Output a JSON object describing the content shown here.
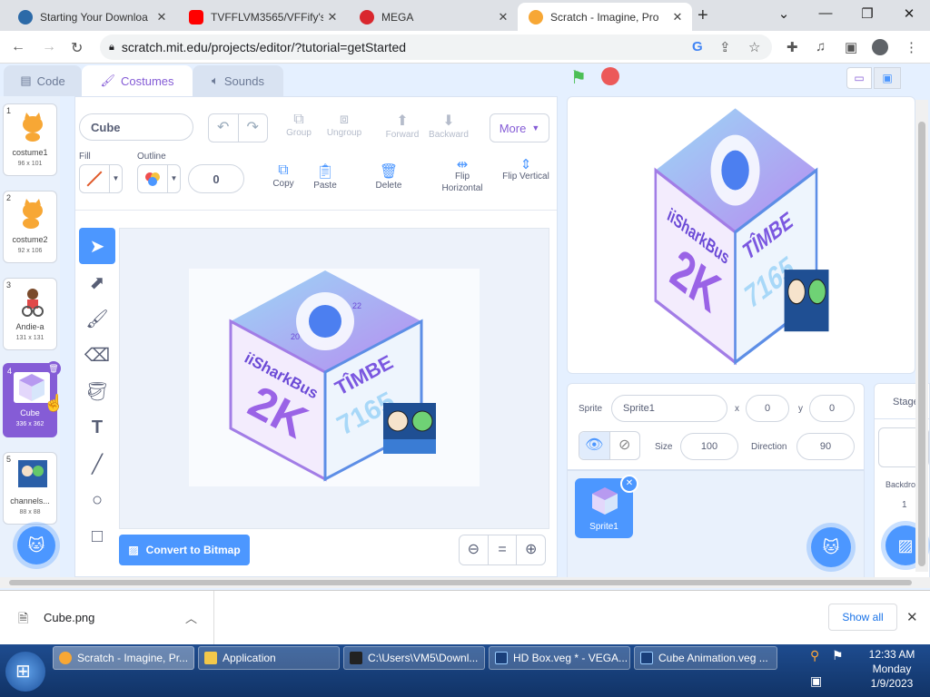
{
  "browser": {
    "tabs": [
      {
        "title": "Starting Your Downloa",
        "favicon_color": "#2c6aa8"
      },
      {
        "title": "TVFFLVM3565/VFFify's",
        "favicon_color": "#ff0000"
      },
      {
        "title": "MEGA",
        "favicon_color": "#d9272e"
      },
      {
        "title": "Scratch - Imagine, Pro",
        "favicon_color": "#f7a735"
      }
    ],
    "new_tab": "+",
    "url": "scratch.mit.edu/projects/editor/?tutorial=getStarted"
  },
  "scratch": {
    "tabs": {
      "code": "Code",
      "costumes": "Costumes",
      "sounds": "Sounds"
    },
    "costumes": [
      {
        "num": "1",
        "name": "costume1",
        "size": "96 x 101"
      },
      {
        "num": "2",
        "name": "costume2",
        "size": "92 x 106"
      },
      {
        "num": "3",
        "name": "Andie-a",
        "size": "131 x 131"
      },
      {
        "num": "4",
        "name": "Cube",
        "size": "336 x 362"
      },
      {
        "num": "5",
        "name": "channels...",
        "size": "88 x 88"
      }
    ],
    "editor": {
      "costume_name": "Cube",
      "fill_label": "Fill",
      "outline_label": "Outline",
      "outline_width": "0",
      "group": "Group",
      "ungroup": "Ungroup",
      "forward": "Forward",
      "backward": "Backward",
      "more": "More",
      "copy": "Copy",
      "paste": "Paste",
      "delete": "Delete",
      "flip_h": "Flip Horizontal",
      "flip_v": "Flip Vertical",
      "convert": "Convert to Bitmap",
      "zoom_reset": "="
    },
    "cube_art": {
      "top_a": "20",
      "top_b": "22",
      "left_line1": "iiSharkBus",
      "left_line2": "2K",
      "right_line1": "TÎMBE",
      "right_line2": "7165"
    },
    "sprite": {
      "label": "Sprite",
      "name": "Sprite1",
      "x_label": "x",
      "x": "0",
      "y_label": "y",
      "y": "0",
      "size_label": "Size",
      "size": "100",
      "dir_label": "Direction",
      "dir": "90",
      "tile_name": "Sprite1"
    },
    "stage_pane": {
      "title": "Stage",
      "backdrops_label": "Backdro",
      "backdrops_count": "1"
    }
  },
  "download": {
    "file": "Cube.png",
    "show_all": "Show all"
  },
  "taskbar": {
    "items": [
      {
        "label": "Scratch - Imagine, Pr...",
        "color": "#f7a735"
      },
      {
        "label": "Application",
        "color": "#f3c84a"
      },
      {
        "label": "C:\\Users\\VM5\\Downl...",
        "color": "#222222"
      },
      {
        "label": "HD Box.veg * - VEGA...",
        "color": "#1a3f7a"
      },
      {
        "label": "Cube Animation.veg ...",
        "color": "#1a3f7a"
      }
    ],
    "time": "12:33 AM",
    "day": "Monday",
    "date": "1/9/2023"
  },
  "colors": {
    "accent": "#855cd6",
    "blue": "#4c97ff",
    "green_flag": "#4cbf56",
    "stop": "#ec5959"
  }
}
